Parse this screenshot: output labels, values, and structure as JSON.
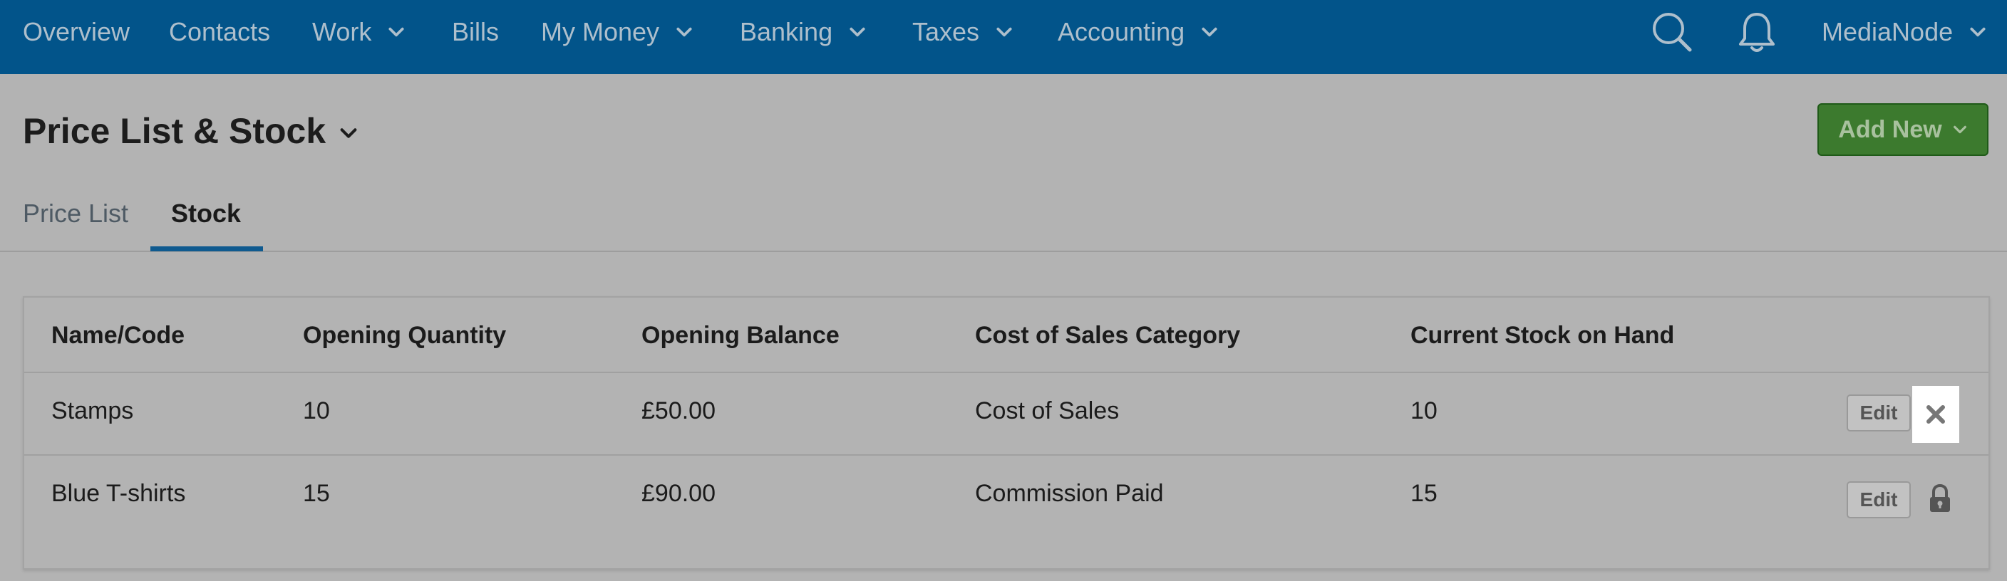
{
  "nav": {
    "items": [
      {
        "label": "Overview",
        "has_dropdown": false
      },
      {
        "label": "Contacts",
        "has_dropdown": false
      },
      {
        "label": "Work",
        "has_dropdown": true
      },
      {
        "label": "Bills",
        "has_dropdown": false
      },
      {
        "label": "My Money",
        "has_dropdown": true
      },
      {
        "label": "Banking",
        "has_dropdown": true
      },
      {
        "label": "Taxes",
        "has_dropdown": true
      },
      {
        "label": "Accounting",
        "has_dropdown": true
      }
    ],
    "search_icon": "search-icon",
    "notifications_icon": "bell-icon",
    "account_label": "MediaNode"
  },
  "header": {
    "title": "Price List & Stock",
    "add_new_label": "Add New"
  },
  "tabs": [
    {
      "label": "Price List",
      "active": false
    },
    {
      "label": "Stock",
      "active": true
    }
  ],
  "table": {
    "columns": [
      "Name/Code",
      "Opening Quantity",
      "Opening Balance",
      "Cost of Sales Category",
      "Current Stock on Hand"
    ],
    "rows": [
      {
        "name": "Stamps",
        "opening_quantity": "10",
        "opening_balance": "£50.00",
        "category": "Cost of Sales",
        "stock_on_hand": "10",
        "edit_label": "Edit",
        "row_action": "delete-icon"
      },
      {
        "name": "Blue T-shirts",
        "opening_quantity": "15",
        "opening_balance": "£90.00",
        "category": "Commission Paid",
        "stock_on_hand": "15",
        "edit_label": "Edit",
        "row_action": "lock-icon"
      }
    ]
  },
  "colors": {
    "nav_background": "#02548a",
    "nav_text": "#aebfcc",
    "page_background": "#b3b3b3",
    "add_new_background": "#3c7a2e",
    "tab_active_underline": "#0f5a8f"
  }
}
